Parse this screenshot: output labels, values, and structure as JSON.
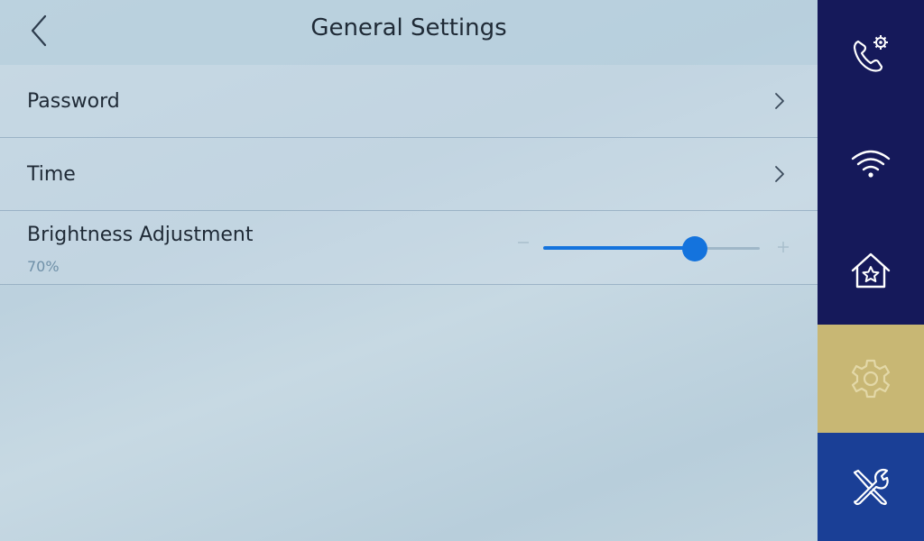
{
  "header": {
    "title": "General Settings",
    "back_icon": "chevron-left-icon"
  },
  "settings": {
    "password": {
      "label": "Password",
      "icon": "chevron-right-icon"
    },
    "time": {
      "label": "Time",
      "icon": "chevron-right-icon"
    },
    "brightness": {
      "label": "Brightness Adjustment",
      "value_text": "70%",
      "level": 0.7,
      "minus_icon": "minus-icon",
      "plus_icon": "plus-icon"
    }
  },
  "sidebar": {
    "items": [
      {
        "icon": "phone-settings-icon",
        "active": false
      },
      {
        "icon": "wifi-icon",
        "active": false
      },
      {
        "icon": "home-star-icon",
        "active": false
      },
      {
        "icon": "gear-icon",
        "active": true
      },
      {
        "icon": "tools-icon",
        "active": false
      }
    ]
  },
  "colors": {
    "accent": "#1473dd",
    "sidebar_bg": "#15195a",
    "sidebar_active": "#c8b774",
    "sidebar_bottom": "#1a3f96",
    "secondary_text": "#6f90a8"
  }
}
